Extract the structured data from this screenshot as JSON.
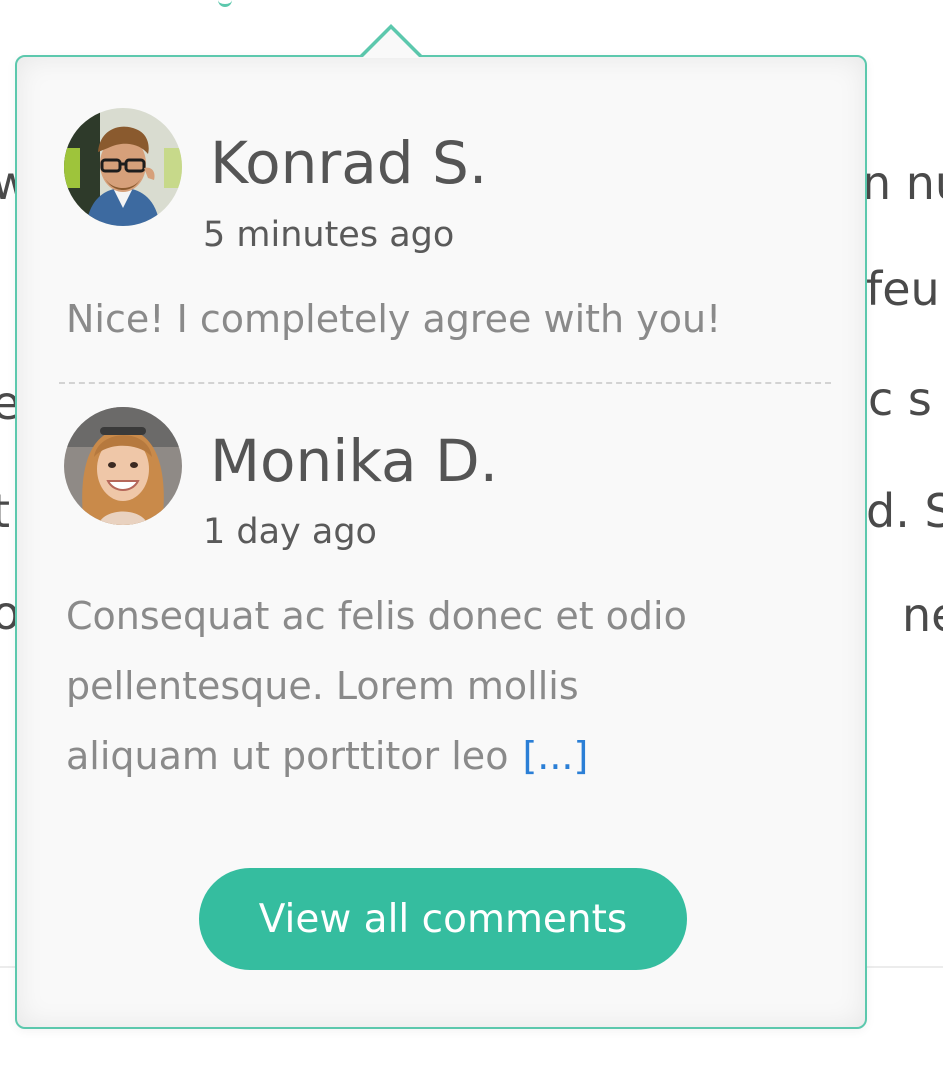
{
  "background_text": {
    "right_fragments": [
      "n  nu",
      "feu",
      "c s",
      "d. S",
      "ne"
    ],
    "left_fragments": [
      "w",
      "",
      "e",
      "t",
      "o"
    ]
  },
  "popover": {
    "comments": [
      {
        "author": "Konrad S.",
        "time": "5 minutes ago",
        "text_lines": [
          "Nice! I completely agree with you!"
        ],
        "more_label": ""
      },
      {
        "author": "Monika D.",
        "time": "1 day ago",
        "text_lines": [
          "Consequat ac felis donec et odio",
          "pellentesque. Lorem mollis",
          "aliquam ut porttitor leo"
        ],
        "more_label": "[...]"
      }
    ],
    "view_all_label": "View all comments"
  },
  "colors": {
    "accent": "#35bd9f",
    "border": "#5cc8ad",
    "link": "#2b7fd6",
    "popover_bg": "#f9f9f9"
  },
  "icons": {
    "avatar_1": "avatar-konrad",
    "avatar_2": "avatar-monika"
  }
}
